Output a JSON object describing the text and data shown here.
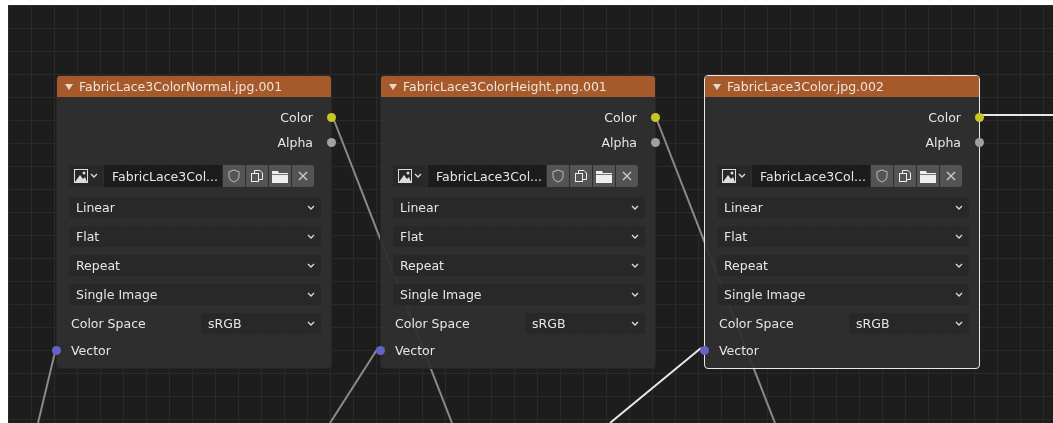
{
  "nodes": [
    {
      "title": "FabricLace3ColorNormal.jpg.001",
      "selected": false,
      "outputs": [
        {
          "label": "Color",
          "color": "#c7c729"
        },
        {
          "label": "Alpha",
          "color": "#a1a1a1"
        }
      ],
      "image": {
        "name": "FabricLace3Col..."
      },
      "dropdowns": [
        "Linear",
        "Flat",
        "Repeat",
        "Single Image"
      ],
      "color_space": {
        "label": "Color Space",
        "value": "sRGB"
      },
      "inputs": [
        {
          "label": "Vector",
          "color": "#6363c7"
        }
      ]
    },
    {
      "title": "FabricLace3ColorHeight.png.001",
      "selected": false,
      "outputs": [
        {
          "label": "Color",
          "color": "#c7c729"
        },
        {
          "label": "Alpha",
          "color": "#a1a1a1"
        }
      ],
      "image": {
        "name": "FabricLace3Col..."
      },
      "dropdowns": [
        "Linear",
        "Flat",
        "Repeat",
        "Single Image"
      ],
      "color_space": {
        "label": "Color Space",
        "value": "sRGB"
      },
      "inputs": [
        {
          "label": "Vector",
          "color": "#6363c7"
        }
      ]
    },
    {
      "title": "FabricLace3Color.jpg.002",
      "selected": true,
      "outputs": [
        {
          "label": "Color",
          "color": "#c7c729"
        },
        {
          "label": "Alpha",
          "color": "#a1a1a1"
        }
      ],
      "image": {
        "name": "FabricLace3Col..."
      },
      "dropdowns": [
        "Linear",
        "Flat",
        "Repeat",
        "Single Image"
      ],
      "color_space": {
        "label": "Color Space",
        "value": "sRGB"
      },
      "inputs": [
        {
          "label": "Vector",
          "color": "#6363c7"
        }
      ]
    }
  ]
}
